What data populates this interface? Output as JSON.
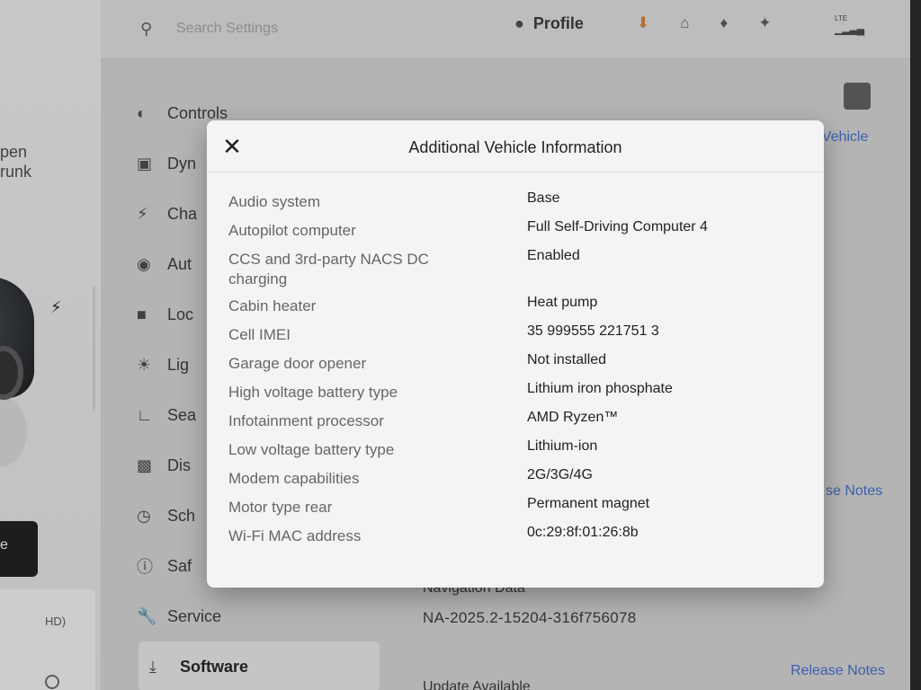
{
  "car_panel": {
    "open_trunk_line1": "pen",
    "open_trunk_line2": "runk",
    "button_fragment": "e"
  },
  "topbar": {
    "search_placeholder": "Search Settings",
    "profile_label": "Profile",
    "lte_label": "LTE"
  },
  "menu": {
    "items": [
      {
        "label": "Controls",
        "icon": "toggle-icon"
      },
      {
        "label": "Dyn",
        "icon": "car-icon"
      },
      {
        "label": "Cha",
        "icon": "bolt-icon"
      },
      {
        "label": "Aut",
        "icon": "steering-wheel-icon"
      },
      {
        "label": "Loc",
        "icon": "lock-icon"
      },
      {
        "label": "Lig",
        "icon": "light-icon"
      },
      {
        "label": "Sea",
        "icon": "seat-icon"
      },
      {
        "label": "Dis",
        "icon": "display-icon"
      },
      {
        "label": "Sch",
        "icon": "schedule-icon"
      },
      {
        "label": "Saf",
        "icon": "safety-icon"
      },
      {
        "label": "Service",
        "icon": "wrench-icon"
      },
      {
        "label": "Software",
        "icon": "download-icon"
      }
    ]
  },
  "background": {
    "vehicle_link": "r Vehicle",
    "release_notes_partial": "se Notes",
    "navigation_data_title": "Navigation Data",
    "navigation_data_value": "NA-2025.2-15204-316f756078",
    "release_notes": "Release Notes",
    "update_available": "Update Available"
  },
  "modal": {
    "title": "Additional Vehicle Information",
    "close_glyph": "✕",
    "rows": [
      {
        "key": "Audio system",
        "value": "Base"
      },
      {
        "key": "Autopilot computer",
        "value": "Full Self-Driving Computer 4"
      },
      {
        "key": "CCS and 3rd-party NACS DC charging",
        "value": "Enabled"
      },
      {
        "key": "Cabin heater",
        "value": "Heat pump"
      },
      {
        "key": "Cell IMEI",
        "value": "35 999555 221751 3"
      },
      {
        "key": "Garage door opener",
        "value": "Not installed"
      },
      {
        "key": "High voltage battery type",
        "value": "Lithium iron phosphate"
      },
      {
        "key": "Infotainment processor",
        "value": "AMD Ryzen™"
      },
      {
        "key": "Low voltage battery type",
        "value": "Lithium-ion"
      },
      {
        "key": "Modem capabilities",
        "value": "2G/3G/4G"
      },
      {
        "key": "Motor type rear",
        "value": "Permanent magnet"
      },
      {
        "key": "Wi-Fi MAC address",
        "value": "0c:29:8f:01:26:8b"
      }
    ]
  },
  "colors": {
    "link_blue": "#3e6ad0",
    "download_orange": "#d97a2b",
    "modal_bg": "#f4f4f4"
  }
}
